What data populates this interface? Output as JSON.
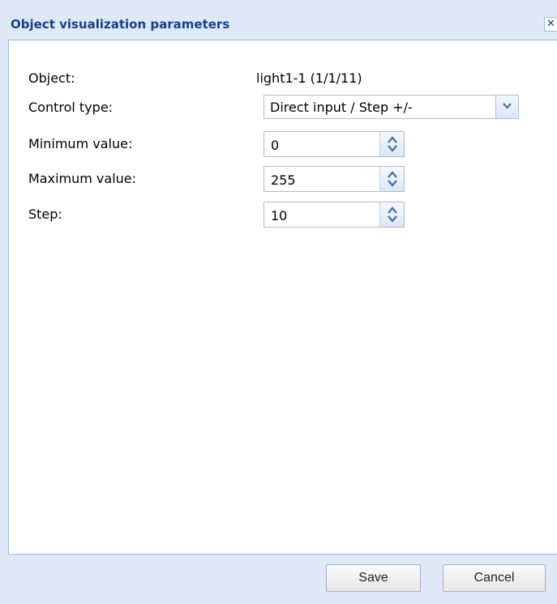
{
  "dialog": {
    "title": "Object visualization parameters",
    "close_icon": "close-icon"
  },
  "fields": {
    "object": {
      "label": "Object:",
      "value": "light1-1 (1/1/11)"
    },
    "control_type": {
      "label": "Control type:",
      "value": "Direct input / Step +/-"
    },
    "minimum": {
      "label": "Minimum value:",
      "value": "0"
    },
    "maximum": {
      "label": "Maximum value:",
      "value": "255"
    },
    "step": {
      "label": "Step:",
      "value": "10"
    }
  },
  "buttons": {
    "save": "Save",
    "cancel": "Cancel"
  },
  "colors": {
    "frame": "#dfe8f6",
    "title_text": "#15428b",
    "border": "#99bbe8"
  }
}
